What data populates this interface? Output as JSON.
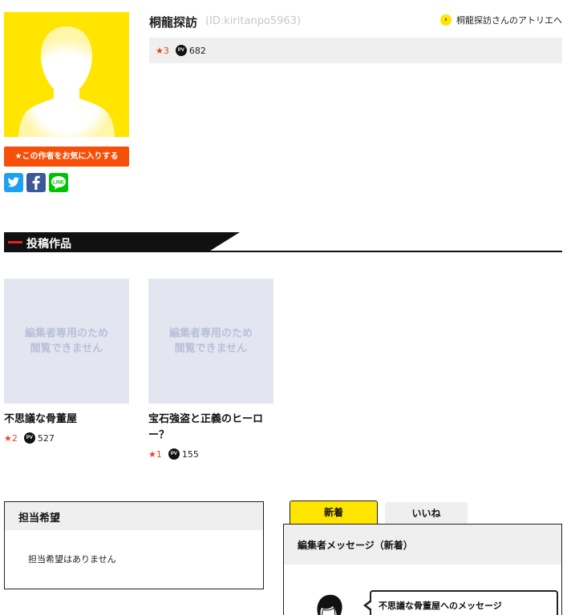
{
  "profile": {
    "name": "桐龍探訪",
    "id_label": "(ID:kiritanpo5963)",
    "atelier_link": "桐龍探訪さんのアトリエへ",
    "favorite_button": "★この作者をお気に入りする",
    "stars": "★3",
    "pv_badge": "PV",
    "pv": "682"
  },
  "share": {
    "twitter": "twitter-icon",
    "facebook": "facebook-icon",
    "line": "LINE"
  },
  "section": {
    "title": "投稿作品"
  },
  "works": [
    {
      "thumb_line1": "編集者専用のため",
      "thumb_line2": "閲覧できません",
      "title": "不思議な骨董屋",
      "stars": "★2",
      "pv": "527"
    },
    {
      "thumb_line1": "編集者専用のため",
      "thumb_line2": "閲覧できません",
      "title": "宝石強盗と正義のヒーロー？",
      "stars": "★1",
      "pv": "155"
    }
  ],
  "tanto": {
    "title": "担当希望",
    "message": "担当希望はありません"
  },
  "tabs": {
    "new": "新着",
    "like": "いいね"
  },
  "messages": {
    "title": "編集者メッセージ（新着）",
    "first": "不思議な骨董屋へのメッセージ"
  },
  "colors": {
    "accent_yellow": "#ffe500",
    "accent_orange": "#f64f0a",
    "star_red": "#e8431c"
  }
}
